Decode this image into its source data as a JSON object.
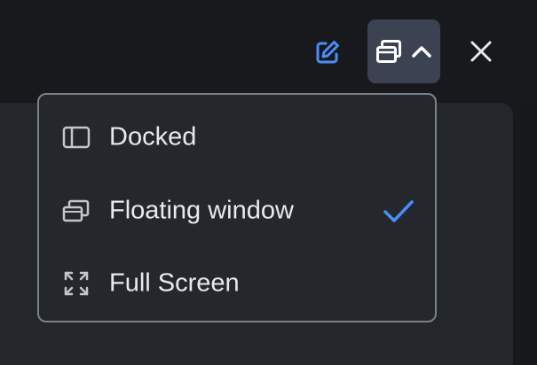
{
  "toolbar": {
    "edit_icon": "edit-icon",
    "window_layout_icon": "floating-window-icon",
    "chevron_icon": "chevron-up-icon",
    "close_icon": "close-icon",
    "accent_color": "#4a8df8"
  },
  "layout_menu": {
    "items": [
      {
        "label": "Docked",
        "icon": "docked-panel-icon",
        "selected": false
      },
      {
        "label": "Floating window",
        "icon": "floating-window-icon",
        "selected": true
      },
      {
        "label": "Full Screen",
        "icon": "full-screen-icon",
        "selected": false
      }
    ],
    "selected_icon": "checkmark-icon"
  }
}
